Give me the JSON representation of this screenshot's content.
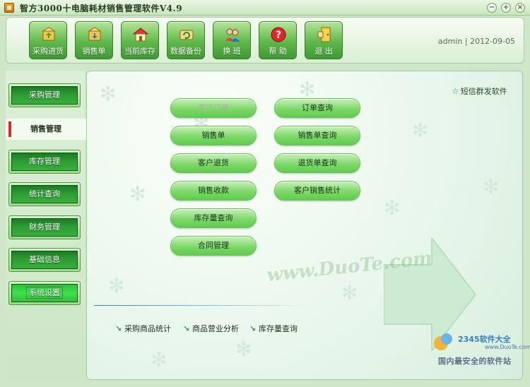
{
  "window": {
    "title": "智方3000十电脑耗材销售管理软件V4.9",
    "controls": [
      "minimize-icon",
      "maximize-icon",
      "close-icon"
    ]
  },
  "toolbar": {
    "buttons": [
      {
        "label": "采购进货",
        "icon": "cart-box-icon"
      },
      {
        "label": "销售单",
        "icon": "sales-box-icon"
      },
      {
        "label": "当前库存",
        "icon": "warehouse-icon"
      },
      {
        "label": "数据备份",
        "icon": "backup-icon"
      },
      {
        "label": "换  班",
        "icon": "shift-users-icon"
      },
      {
        "label": "帮  助",
        "icon": "help-icon"
      },
      {
        "label": "退  出",
        "icon": "exit-door-icon"
      }
    ],
    "user": "admin",
    "date": "2012-09-05",
    "user_info": "admin | 2012-09-05"
  },
  "sidebar": {
    "items": [
      {
        "label": "采购管理",
        "active": false
      },
      {
        "label": "销售管理",
        "active": true
      },
      {
        "label": "库存管理",
        "active": false
      },
      {
        "label": "统计查询",
        "active": false
      },
      {
        "label": "财务管理",
        "active": false
      },
      {
        "label": "基础信息",
        "active": false
      },
      {
        "label": "系统设置",
        "active": false,
        "focused": true
      }
    ]
  },
  "main": {
    "sms_link": "短信群发软件",
    "actions_left": [
      "客户订单",
      "销售单",
      "客户退货",
      "销售收款",
      "库存量查询",
      "合同管理"
    ],
    "actions_right": [
      "订单查询",
      "销售单查询",
      "退货单查询",
      "客户销售统计"
    ],
    "quick_links": [
      "采购商品统计",
      "商品营业分析",
      "库存量查询"
    ],
    "watermark_center": "www.DuoTe.com",
    "watermark_brand": "2345软件大全",
    "watermark_url": "www.DuoTe.com",
    "watermark_slogan": "国内最安全的软件站",
    "colors": {
      "accent_green": "#5fcb4d",
      "active_marker": "#e02828",
      "divider_blue": "#2c82b4"
    }
  }
}
